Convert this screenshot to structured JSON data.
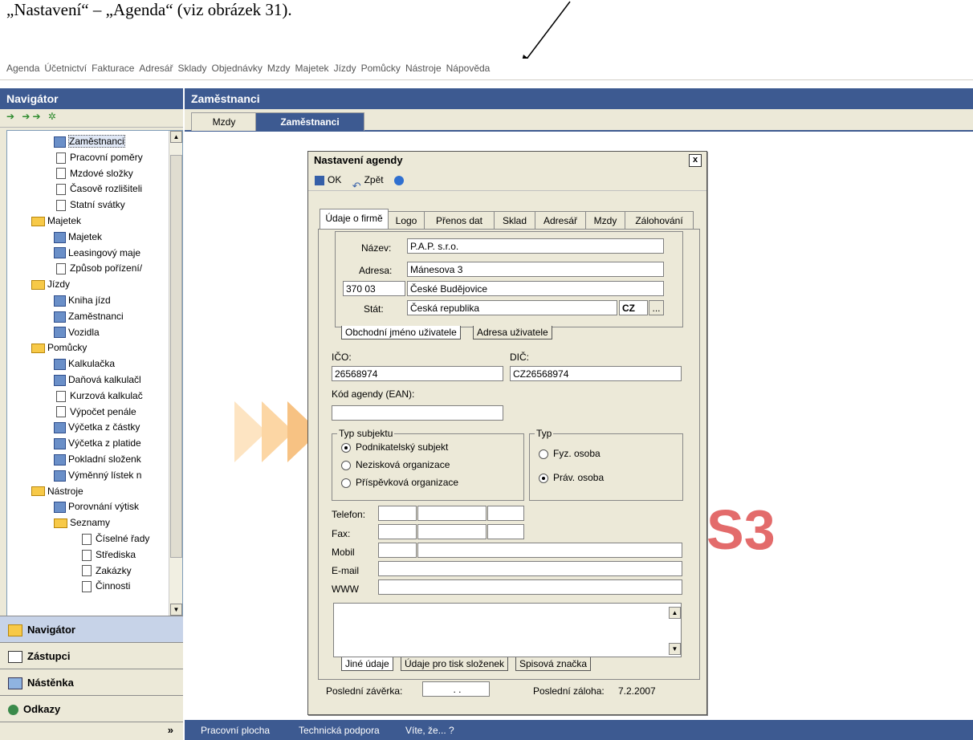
{
  "caption": "„Nastavení“ – „Agenda“ (viz obrázek 31).",
  "menu": [
    "Agenda",
    "Účetnictví",
    "Fakturace",
    "Adresář",
    "Sklady",
    "Objednávky",
    "Mzdy",
    "Majetek",
    "Jízdy",
    "Pomůcky",
    "Nástroje",
    "Nápověda"
  ],
  "navigator": {
    "title": "Navigátor",
    "tree": [
      {
        "label": "Zaměstnanci",
        "level": 3,
        "icon": "people",
        "selected": true
      },
      {
        "label": "Pracovní poměry",
        "level": 3,
        "icon": "doc"
      },
      {
        "label": "Mzdové složky",
        "level": 3,
        "icon": "doc"
      },
      {
        "label": "Časově rozlišiteli",
        "level": 3,
        "icon": "doc"
      },
      {
        "label": "Statní svátky",
        "level": 3,
        "icon": "doc"
      },
      {
        "label": "Majetek",
        "level": 2,
        "icon": "folder"
      },
      {
        "label": "Majetek",
        "level": 3,
        "icon": "app"
      },
      {
        "label": "Leasingový maje",
        "level": 3,
        "icon": "app"
      },
      {
        "label": "Způsob pořízení/",
        "level": 3,
        "icon": "doc"
      },
      {
        "label": "Jízdy",
        "level": 2,
        "icon": "folder"
      },
      {
        "label": "Kniha jízd",
        "level": 3,
        "icon": "app"
      },
      {
        "label": "Zaměstnanci",
        "level": 3,
        "icon": "people"
      },
      {
        "label": "Vozidla",
        "level": 3,
        "icon": "car"
      },
      {
        "label": "Pomůcky",
        "level": 2,
        "icon": "folder"
      },
      {
        "label": "Kalkulačka",
        "level": 3,
        "icon": "app"
      },
      {
        "label": "Daňová kalkulačl",
        "level": 3,
        "icon": "app"
      },
      {
        "label": "Kurzová kalkulač",
        "level": 3,
        "icon": "doc"
      },
      {
        "label": "Výpočet penále",
        "level": 3,
        "icon": "doc"
      },
      {
        "label": "Výčetka z částky",
        "level": 3,
        "icon": "app"
      },
      {
        "label": "Výčetka z platide",
        "level": 3,
        "icon": "app"
      },
      {
        "label": "Pokladní složenk",
        "level": 3,
        "icon": "app"
      },
      {
        "label": "Výměnný lístek n",
        "level": 3,
        "icon": "app"
      },
      {
        "label": "Nástroje",
        "level": 2,
        "icon": "folder"
      },
      {
        "label": "Porovnání výtisk",
        "level": 3,
        "icon": "app"
      },
      {
        "label": "Seznamy",
        "level": 3,
        "icon": "folder"
      },
      {
        "label": "Číselné řady",
        "level": 4,
        "icon": "doc"
      },
      {
        "label": "Střediska",
        "level": 4,
        "icon": "doc"
      },
      {
        "label": "Zakázky",
        "level": 4,
        "icon": "doc"
      },
      {
        "label": "Činnosti",
        "level": 4,
        "icon": "doc"
      }
    ],
    "buttons": [
      "Navigátor",
      "Zástupci",
      "Nástěnka",
      "Odkazy"
    ]
  },
  "main": {
    "title": "Zaměstnanci",
    "tabs": [
      "Mzdy",
      "Zaměstnanci"
    ],
    "active_tab": 1,
    "logo_text": "S3",
    "bottom_tabs": [
      "Pracovní plocha",
      "Technická podpora",
      "Víte, že... ?"
    ]
  },
  "dialog": {
    "title": "Nastavení agendy",
    "close": "x",
    "toolbar": {
      "ok": "OK",
      "back": "Zpět"
    },
    "tabs": [
      "Údaje o firmě",
      "Logo",
      "Přenos dat",
      "Sklad",
      "Adresář",
      "Mzdy",
      "Zálohování"
    ],
    "active_tab": 0,
    "name_label": "Název:",
    "name_value": "P.A.P. s.r.o.",
    "address_label": "Adresa:",
    "street": "Mánesova 3",
    "zip": "370 03",
    "city": "České Budějovice",
    "state_label": "Stát:",
    "state_value": "Česká republika",
    "state_code": "CZ",
    "state_more": "...",
    "addr_tabs": [
      "Obchodní jméno uživatele",
      "Adresa uživatele"
    ],
    "ico_label": "IČO:",
    "ico_value": "26568974",
    "dic_label": "DIČ:",
    "dic_value": "CZ26568974",
    "ean_label": "Kód agendy (EAN):",
    "ean_value": "",
    "subject_group": "Typ subjektu",
    "subject_options": [
      "Podnikatelský subjekt",
      "Nezisková organizace",
      "Příspěvková organizace"
    ],
    "subject_selected": 0,
    "type_group": "Typ",
    "type_options": [
      "Fyz. osoba",
      "Práv. osoba"
    ],
    "type_selected": 1,
    "contact_labels": [
      "Telefon:",
      "Fax:",
      "Mobil",
      "E-mail",
      "WWW"
    ],
    "notes_tabs": [
      "Jiné údaje",
      "Údaje pro tisk složenek",
      "Spisová značka"
    ],
    "last_close_label": "Poslední závěrka:",
    "last_close_value": ". .",
    "last_backup_label": "Poslední záloha:",
    "last_backup_value": "7.2.2007"
  }
}
